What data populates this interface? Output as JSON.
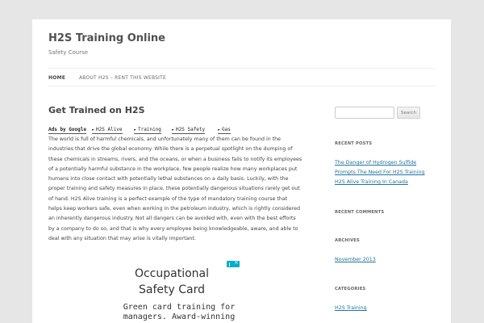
{
  "site": {
    "title": "H2S Training Online",
    "description": "Safety Course"
  },
  "nav": {
    "items": [
      {
        "label": "HOME"
      },
      {
        "label": "ABOUT H2S – RENT THIS WEBSITE"
      }
    ]
  },
  "entry": {
    "title": "Get Trained on H2S",
    "ads_label": "Ads by Google",
    "ad_links": [
      "H2S Alive",
      "Training",
      "H2S Safety",
      "Gas"
    ],
    "body": "The world is full of harmful chemicals, and unfortunately many of them can be found in the industries that drive the global economy. While there is a perpetual spotlight on the dumping of these chemicals in streams, rivers, and the oceans, or when a business fails to notify its employees of a potentially harmful substance in the workplace, few people realize how many workplaces put humans into close contact with potentially lethal substances on a daily basis. Luckily, with the proper training and safety measures in place, these potentially dangerous situations rarely get out of hand. H2S Alive training is a perfect example of the type of mandatory training course that helps keep workers safe, even when working in the petroleum industry, which is rightly considered an inherently dangerous industry. Not all dangers can be avoided with, even with the best efforts by a company to do so, and that is why every employee being knowledgeable, aware, and able to deal with any situation that may arise is vitally important."
  },
  "ad": {
    "title_line1": "Occupational",
    "title_line2": "Safety Card",
    "text_line1": "Green card training for",
    "text_line2": "managers. Award-winning"
  },
  "sidebar": {
    "search_button": "Search",
    "search_value": "",
    "recent_posts_title": "RECENT POSTS",
    "recent_posts": [
      "The Danger of Hydrogen Sulfide Prompts The Need For H2S Training",
      "H2S Alive Training In Canada"
    ],
    "recent_comments_title": "RECENT COMMENTS",
    "archives_title": "ARCHIVES",
    "archives": [
      "November 2013"
    ],
    "categories_title": "CATEGORIES",
    "categories": [
      "H2S Training"
    ]
  },
  "colors": {
    "link": "#21759b",
    "ad_badge": "#00aecd",
    "background": "#e6e6e6"
  }
}
